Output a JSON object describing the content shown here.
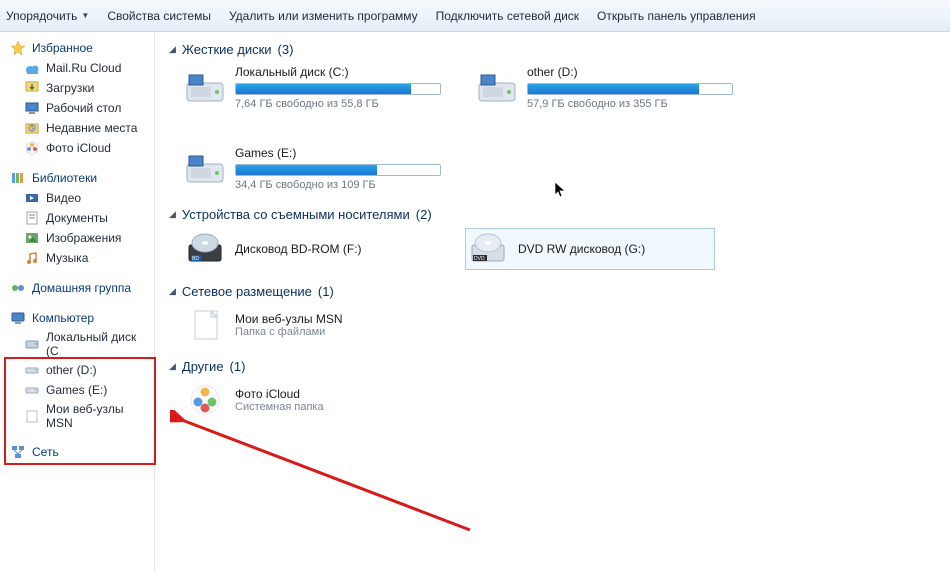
{
  "toolbar": {
    "organize": "Упорядочить",
    "props": "Свойства системы",
    "uninstall": "Удалить или изменить программу",
    "mapdrive": "Подключить сетевой диск",
    "controlpanel": "Открыть панель управления"
  },
  "sidebar": {
    "favorites": {
      "title": "Избранное",
      "items": [
        {
          "label": "Mail.Ru Cloud",
          "icon": "cloud"
        },
        {
          "label": "Загрузки",
          "icon": "download"
        },
        {
          "label": "Рабочий стол",
          "icon": "desktop"
        },
        {
          "label": "Недавние места",
          "icon": "recent"
        },
        {
          "label": "Фото iCloud",
          "icon": "photos"
        }
      ]
    },
    "libraries": {
      "title": "Библиотеки",
      "items": [
        {
          "label": "Видео",
          "icon": "video"
        },
        {
          "label": "Документы",
          "icon": "doc"
        },
        {
          "label": "Изображения",
          "icon": "image"
        },
        {
          "label": "Музыка",
          "icon": "music"
        }
      ]
    },
    "homegroup": {
      "title": "Домашняя группа"
    },
    "computer": {
      "title": "Компьютер",
      "items": [
        {
          "label": "Локальный диск (C",
          "icon": "hdd"
        },
        {
          "label": "other (D:)",
          "icon": "hdd2"
        },
        {
          "label": "Games (E:)",
          "icon": "hdd2"
        },
        {
          "label": "Мои веб-узлы MSN",
          "icon": "folder"
        }
      ]
    },
    "network": {
      "title": "Сеть"
    }
  },
  "sections": {
    "hdd": {
      "title": "Жесткие диски",
      "count": 3,
      "drives": [
        {
          "name": "Локальный диск (C:)",
          "free": "7,64 ГБ свободно из 55,8 ГБ",
          "fill": 86
        },
        {
          "name": "other (D:)",
          "free": "57,9 ГБ свободно из 355 ГБ",
          "fill": 84
        },
        {
          "name": "Games (E:)",
          "free": "34,4 ГБ свободно из 109 ГБ",
          "fill": 69
        }
      ]
    },
    "removable": {
      "title": "Устройства со съемными носителями",
      "count": 2,
      "items": [
        {
          "name": "Дисковод BD-ROM (F:)",
          "icon": "bd"
        },
        {
          "name": "DVD RW дисковод (G:)",
          "icon": "dvd",
          "hover": true
        }
      ]
    },
    "network": {
      "title": "Сетевое размещение",
      "count": 1,
      "items": [
        {
          "name": "Мои веб-узлы MSN",
          "sub": "Папка с файлами",
          "icon": "page"
        }
      ]
    },
    "other": {
      "title": "Другие",
      "count": 1,
      "items": [
        {
          "name": "Фото iCloud",
          "sub": "Системная папка",
          "icon": "photos"
        }
      ]
    }
  }
}
